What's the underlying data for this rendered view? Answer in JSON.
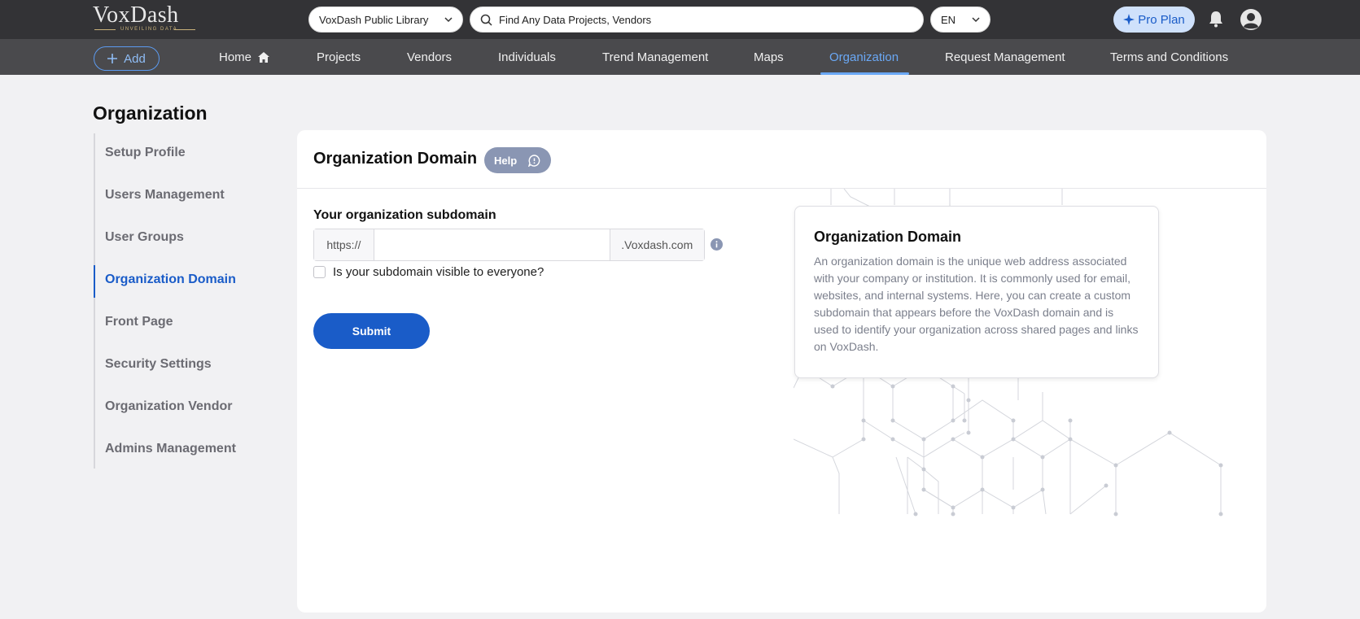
{
  "header": {
    "logo_text": "VoxDash",
    "logo_tagline": "UNVEILING DATA",
    "library_select": "VoxDash Public Library",
    "search_placeholder": "Find Any Data Projects, Vendors",
    "language": "EN",
    "pro_label": "Pro Plan"
  },
  "nav": {
    "add_label": "Add",
    "items": [
      "Home",
      "Projects",
      "Vendors",
      "Individuals",
      "Trend Management",
      "Maps",
      "Organization",
      "Request Management",
      "Terms and Conditions"
    ],
    "active": "Organization"
  },
  "page": {
    "title": "Organization",
    "sidebar": [
      "Setup Profile",
      "Users Management",
      "User Groups",
      "Organization Domain",
      "Front Page",
      "Security Settings",
      "Organization Vendor",
      "Admins Management"
    ],
    "sidebar_active": "Organization Domain"
  },
  "card": {
    "title": "Organization Domain",
    "help_label": "Help",
    "subdomain_label": "Your organization subdomain",
    "prefix": "https://",
    "subdomain_value": "",
    "suffix": ".Voxdash.com",
    "visibility_label": "Is your subdomain visible to everyone?",
    "visibility_checked": false,
    "submit_label": "Submit"
  },
  "info": {
    "title": "Organization Domain",
    "body": "An organization domain is the unique web address associated with your company or institution. It is commonly used for email, websites, and internal systems. Here, you can create a custom subdomain that appears before the VoxDash domain and is used to identify your organization across shared pages and links on VoxDash."
  },
  "colors": {
    "accent": "#1a5cc8",
    "topbar": "#333336",
    "navbar": "#4a4a4d",
    "help_pill": "#8a96b3"
  }
}
